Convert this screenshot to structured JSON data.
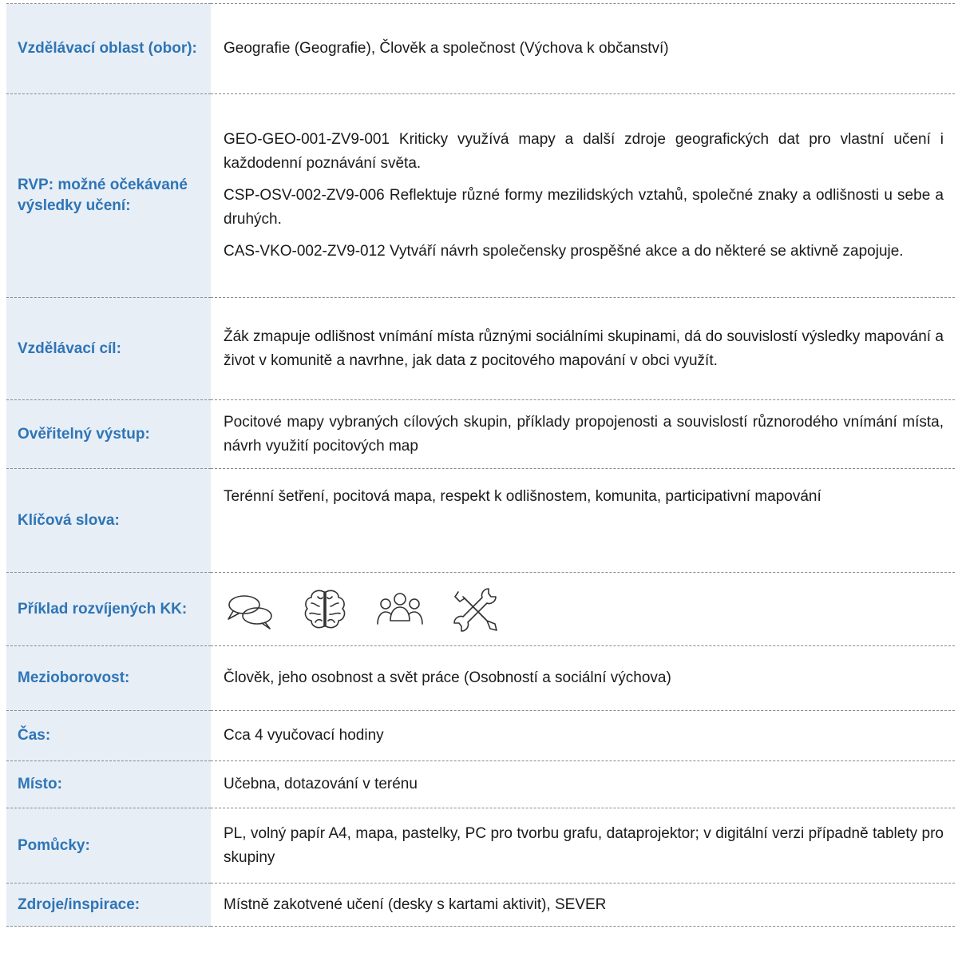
{
  "rows": [
    {
      "label": "Vzdělávací oblast (obor):",
      "lines": [
        "Geografie (Geografie), Člověk a společnost (Výchova k občanství)"
      ]
    },
    {
      "label": "RVP: možné očekávané výsledky učení:",
      "lines": [
        "GEO-GEO-001-ZV9-001 Kriticky využívá mapy a další zdroje geografických dat pro vlastní učení i každodenní poznávání světa.",
        "CSP-OSV-002-ZV9-006 Reflektuje různé formy mezilidských vztahů, společné znaky a odlišnosti u sebe a druhých.",
        "CAS-VKO-002-ZV9-012 Vytváří návrh společensky prospěšné akce a do některé se aktivně zapojuje."
      ]
    },
    {
      "label": "Vzdělávací cíl:",
      "lines": [
        "Žák zmapuje odlišnost vnímání místa různými sociálními skupinami, dá do souvislostí výsledky mapování a život v komunitě a navrhne, jak data z pocitového mapování v obci využít."
      ]
    },
    {
      "label": "Ověřitelný výstup:",
      "lines": [
        "Pocitové mapy vybraných cílových skupin, příklady propojenosti a souvislostí různorodého vnímání místa, návrh využití pocitových map"
      ]
    },
    {
      "label": "Klíčová slova:",
      "lines": [
        "Terénní šetření, pocitová mapa, respekt k odlišnostem, komunita, participativní mapování"
      ]
    },
    {
      "label": "Příklad rozvíjených KK:",
      "icons": [
        "speech-bubbles-icon",
        "brain-icon",
        "people-group-icon",
        "wrench-screwdriver-icon"
      ]
    },
    {
      "label": "Mezioborovost:",
      "lines": [
        "Člověk, jeho osobnost a svět práce (Osobností a sociální výchova)"
      ]
    },
    {
      "label": "Čas:",
      "lines": [
        "Cca 4 vyučovací hodiny"
      ]
    },
    {
      "label": "Místo:",
      "lines": [
        "Učebna, dotazování v terénu"
      ]
    },
    {
      "label": "Pomůcky:",
      "lines": [
        "PL, volný papír A4, mapa, pastelky, PC pro tvorbu grafu, dataprojektor; v digitální verzi případně tablety pro skupiny"
      ]
    },
    {
      "label": "Zdroje/inspirace:",
      "lines": [
        "Místně zakotvené učení (desky s kartami aktivit), SEVER"
      ]
    }
  ],
  "colors": {
    "label_text": "#2e75b6",
    "label_bg": "#e8eef6",
    "border": "#8a8a8a"
  }
}
